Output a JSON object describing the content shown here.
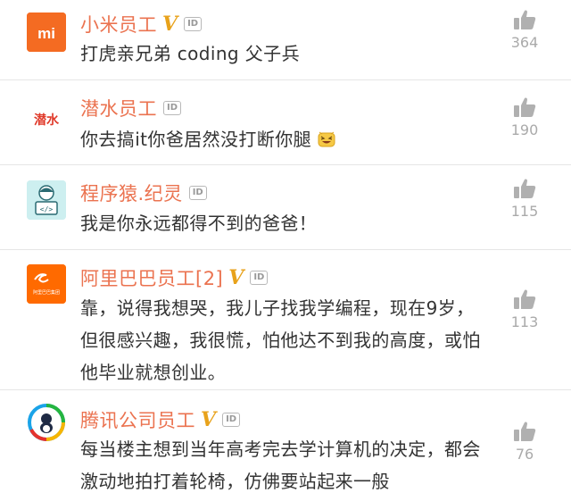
{
  "comments": [
    {
      "author": "小米员工",
      "verified": true,
      "id_badge": "ID",
      "content": "打虎亲兄弟 coding 父子兵",
      "likes": "364",
      "avatar": {
        "text": "mi",
        "bg": "#f46b22",
        "fg": "#ffffff",
        "icon": "xiaomi-logo"
      }
    },
    {
      "author": "潜水员工",
      "verified": false,
      "id_badge": "ID",
      "content": "你去搞it你爸居然没打断你腿",
      "likes": "190",
      "avatar": {
        "text": "潜水",
        "bg": "#ffffff",
        "fg": "#e03a2a",
        "icon": "diving-logo"
      }
    },
    {
      "author": "程序猿.纪灵",
      "verified": false,
      "id_badge": "ID",
      "content": "我是你永远都得不到的爸爸！",
      "likes": "115",
      "avatar": {
        "text": "</>",
        "bg": "#cdeff0",
        "fg": "#2a6a72",
        "icon": "programmer-logo"
      }
    },
    {
      "author": "阿里巴巴员工[2]",
      "verified": true,
      "id_badge": "ID",
      "content_lines": [
        "靠，说得我想哭，我儿子找我学编程，现在9岁，",
        "但很感兴趣，我很慌，怕他达不到我的高度，或怕",
        "他毕业就想创业。"
      ],
      "likes": "113",
      "avatar": {
        "text": "阿里巴巴集团",
        "bg": "#ff6a00",
        "fg": "#ffffff",
        "icon": "alibaba-logo"
      }
    },
    {
      "author": "腾讯公司员工",
      "verified": true,
      "id_badge": "ID",
      "content_lines": [
        "每当楼主想到当年高考完去学计算机的决定，都会",
        "激动地拍打着轮椅，仿佛要站起来一般"
      ],
      "likes": "76",
      "avatar": {
        "text": "",
        "bg": "#ffffff",
        "fg": "#1aa3e8",
        "icon": "tencent-logo"
      }
    }
  ],
  "colors": {
    "name": "#eb7350",
    "v_badge": "#e8a21b",
    "like_icon": "#b0b0b0",
    "like_count": "#aaaaaa"
  }
}
